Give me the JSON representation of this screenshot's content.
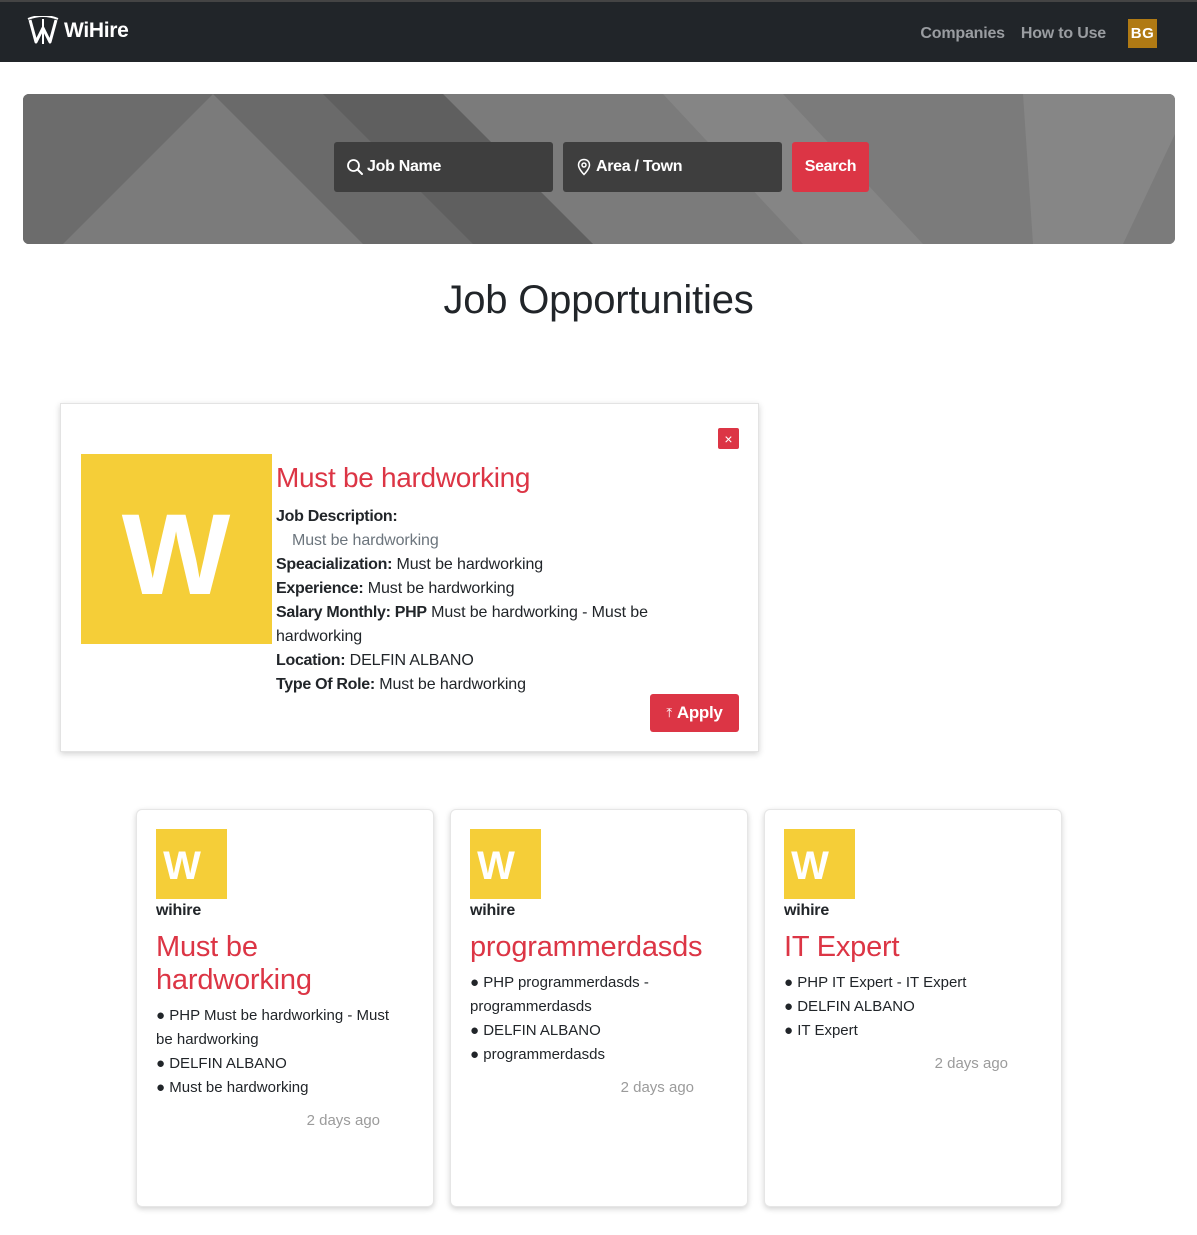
{
  "navbar": {
    "brand": "WiHire",
    "links": [
      "Companies",
      "How to Use"
    ],
    "avatar_initials": "BG"
  },
  "search": {
    "job_placeholder": "Job Name",
    "area_placeholder": "Area / Town",
    "button_label": "Search"
  },
  "page_title": "Job Opportunities",
  "detail": {
    "logo_letter": "W",
    "title": "Must be hardworking",
    "job_description_label": "Job Description:",
    "job_description": "Must be hardworking",
    "specialization_label": "Speacialization:",
    "specialization": "Must be hardworking",
    "experience_label": "Experience:",
    "experience": "Must be hardworking",
    "salary_label": "Salary Monthly: PHP",
    "salary": "Must be hardworking - Must be hardworking",
    "location_label": "Location:",
    "location": "DELFIN ALBANO",
    "role_label": "Type Of Role:",
    "role": "Must be hardworking",
    "apply_label": "Apply",
    "close_icon": "×"
  },
  "jobs": [
    {
      "logo_letter": "W",
      "company": "wihire",
      "title": "Must be hardworking",
      "salary": "● PHP Must be hardworking - Must be hardworking",
      "location": "● DELFIN ALBANO",
      "role": "● Must be hardworking",
      "posted": "2 days ago"
    },
    {
      "logo_letter": "W",
      "company": "wihire",
      "title": "programmerdasds",
      "salary": "● PHP programmerdasds - programmerdasds",
      "location": "● DELFIN ALBANO",
      "role": "● programmerdasds",
      "posted": "2 days ago"
    },
    {
      "logo_letter": "W",
      "company": "wihire",
      "title": "IT Expert",
      "salary": "● PHP IT Expert - IT Expert",
      "location": "● DELFIN ALBANO",
      "role": "● IT Expert",
      "posted": "2 days ago"
    }
  ],
  "colors": {
    "navbar": "#212529",
    "accent": "#dc3545",
    "logo_yellow": "#f5ce38",
    "avatar": "#b07a14"
  }
}
